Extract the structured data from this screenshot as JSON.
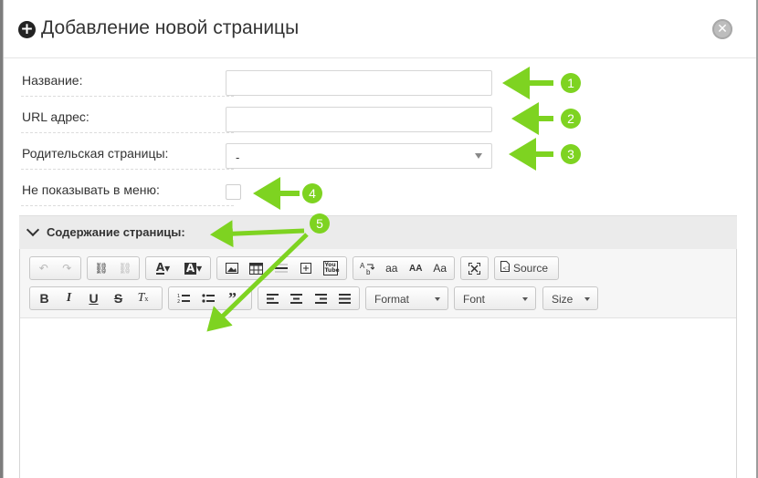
{
  "dialog": {
    "title": "Добавление новой страницы",
    "title_icon": "plus-circle-icon",
    "close_icon": "close-circle-icon"
  },
  "form": {
    "name_label": "Название:",
    "url_label": "URL адрес:",
    "parent_label": "Родительская страницы:",
    "parent_value": "-",
    "hide_label": "Не показывать в меню:",
    "hide_checked": false
  },
  "content_section": {
    "title": "Содержание страницы:",
    "expanded": true
  },
  "toolbar": {
    "source_label": "Source",
    "format_label": "Format",
    "font_label": "Font",
    "size_label": "Size",
    "icons": [
      "undo-icon",
      "redo-icon",
      "link-icon",
      "unlink-icon",
      "text-color-icon",
      "bg-color-icon",
      "image-icon",
      "table-icon",
      "horizontal-rule-icon",
      "special-char-icon",
      "youtube-icon",
      "find-replace-icon",
      "lowercase-icon",
      "uppercase-icon",
      "capitalize-icon",
      "maximize-icon",
      "source-icon",
      "bold-icon",
      "italic-icon",
      "underline-icon",
      "strikethrough-icon",
      "remove-format-icon",
      "numbered-list-icon",
      "bulleted-list-icon",
      "blockquote-icon",
      "align-left-icon",
      "align-center-icon",
      "align-right-icon",
      "justify-icon"
    ],
    "youtube_text": "You Tube",
    "lowercase_text": "aa",
    "uppercase_text": "AA",
    "capitalize_text": "Aa"
  },
  "annotations": {
    "badges": [
      "1",
      "2",
      "3",
      "4",
      "5"
    ],
    "color": "#7ed321"
  },
  "colors": {
    "accent": "#7ed321",
    "section_bg": "#ebebeb"
  }
}
